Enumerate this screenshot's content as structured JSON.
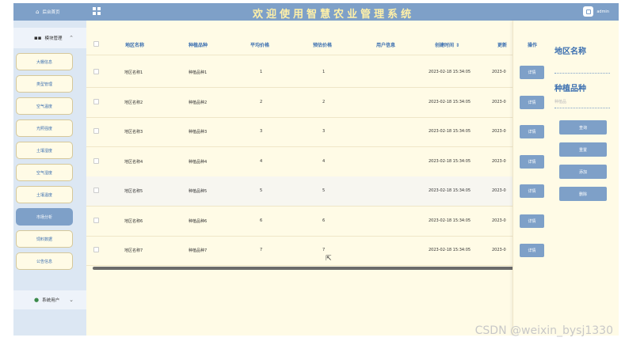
{
  "sidebar": {
    "home_label": "后台首页",
    "group_label": "模块管理",
    "items": [
      {
        "label": "大棚信息",
        "active": false
      },
      {
        "label": "类型管理",
        "active": false
      },
      {
        "label": "空气温度",
        "active": false
      },
      {
        "label": "光照强度",
        "active": false
      },
      {
        "label": "土壤湿度",
        "active": false
      },
      {
        "label": "空气湿度",
        "active": false
      },
      {
        "label": "土壤温度",
        "active": false
      },
      {
        "label": "市场分析",
        "active": true
      },
      {
        "label": "饲料数据",
        "active": false
      },
      {
        "label": "公告信息",
        "active": false
      }
    ],
    "user_group_label": "系统用户"
  },
  "header": {
    "title": "欢迎使用智慧农业管理系统",
    "user": "admin"
  },
  "table": {
    "columns": [
      "地区名称",
      "种植品种",
      "平均价格",
      "预估价格",
      "用户信息",
      "创建时间 ⇕",
      "更新"
    ],
    "rows": [
      {
        "region": "地区名称1",
        "variety": "种植品种1",
        "avg": "1",
        "est": "1",
        "created": "2023-02-18 15:34:05",
        "updated": "2023-0"
      },
      {
        "region": "地区名称2",
        "variety": "种植品种2",
        "avg": "2",
        "est": "2",
        "created": "2023-02-18 15:34:05",
        "updated": "2023-0"
      },
      {
        "region": "地区名称3",
        "variety": "种植品种3",
        "avg": "3",
        "est": "3",
        "created": "2023-02-18 15:34:05",
        "updated": "2023-0"
      },
      {
        "region": "地区名称4",
        "variety": "种植品种4",
        "avg": "4",
        "est": "4",
        "created": "2023-02-18 15:34:05",
        "updated": "2023-0"
      },
      {
        "region": "地区名称5",
        "variety": "种植品种5",
        "avg": "5",
        "est": "5",
        "created": "2023-02-18 15:34:05",
        "updated": "2023-0"
      },
      {
        "region": "地区名称6",
        "variety": "种植品种6",
        "avg": "6",
        "est": "6",
        "created": "2023-02-18 15:34:05",
        "updated": "2023-0"
      },
      {
        "region": "地区名称7",
        "variety": "种植品种7",
        "avg": "7",
        "est": "7",
        "created": "2023-02-18 15:34:05",
        "updated": "2023-0"
      }
    ],
    "ops_header": "操作",
    "detail_label": "详情"
  },
  "search": {
    "region_label": "地区名称",
    "variety_label": "种植品种",
    "region_placeholder": "",
    "variety_placeholder": "种植品",
    "buttons": [
      "查询",
      "重置",
      "添加",
      "删除"
    ]
  },
  "watermark": "CSDN @weixin_bysj1330",
  "colors": {
    "primary": "#7ea0c8",
    "title": "#fff0a8",
    "background": "#fffbe6",
    "sidebar": "#dce7f3"
  }
}
